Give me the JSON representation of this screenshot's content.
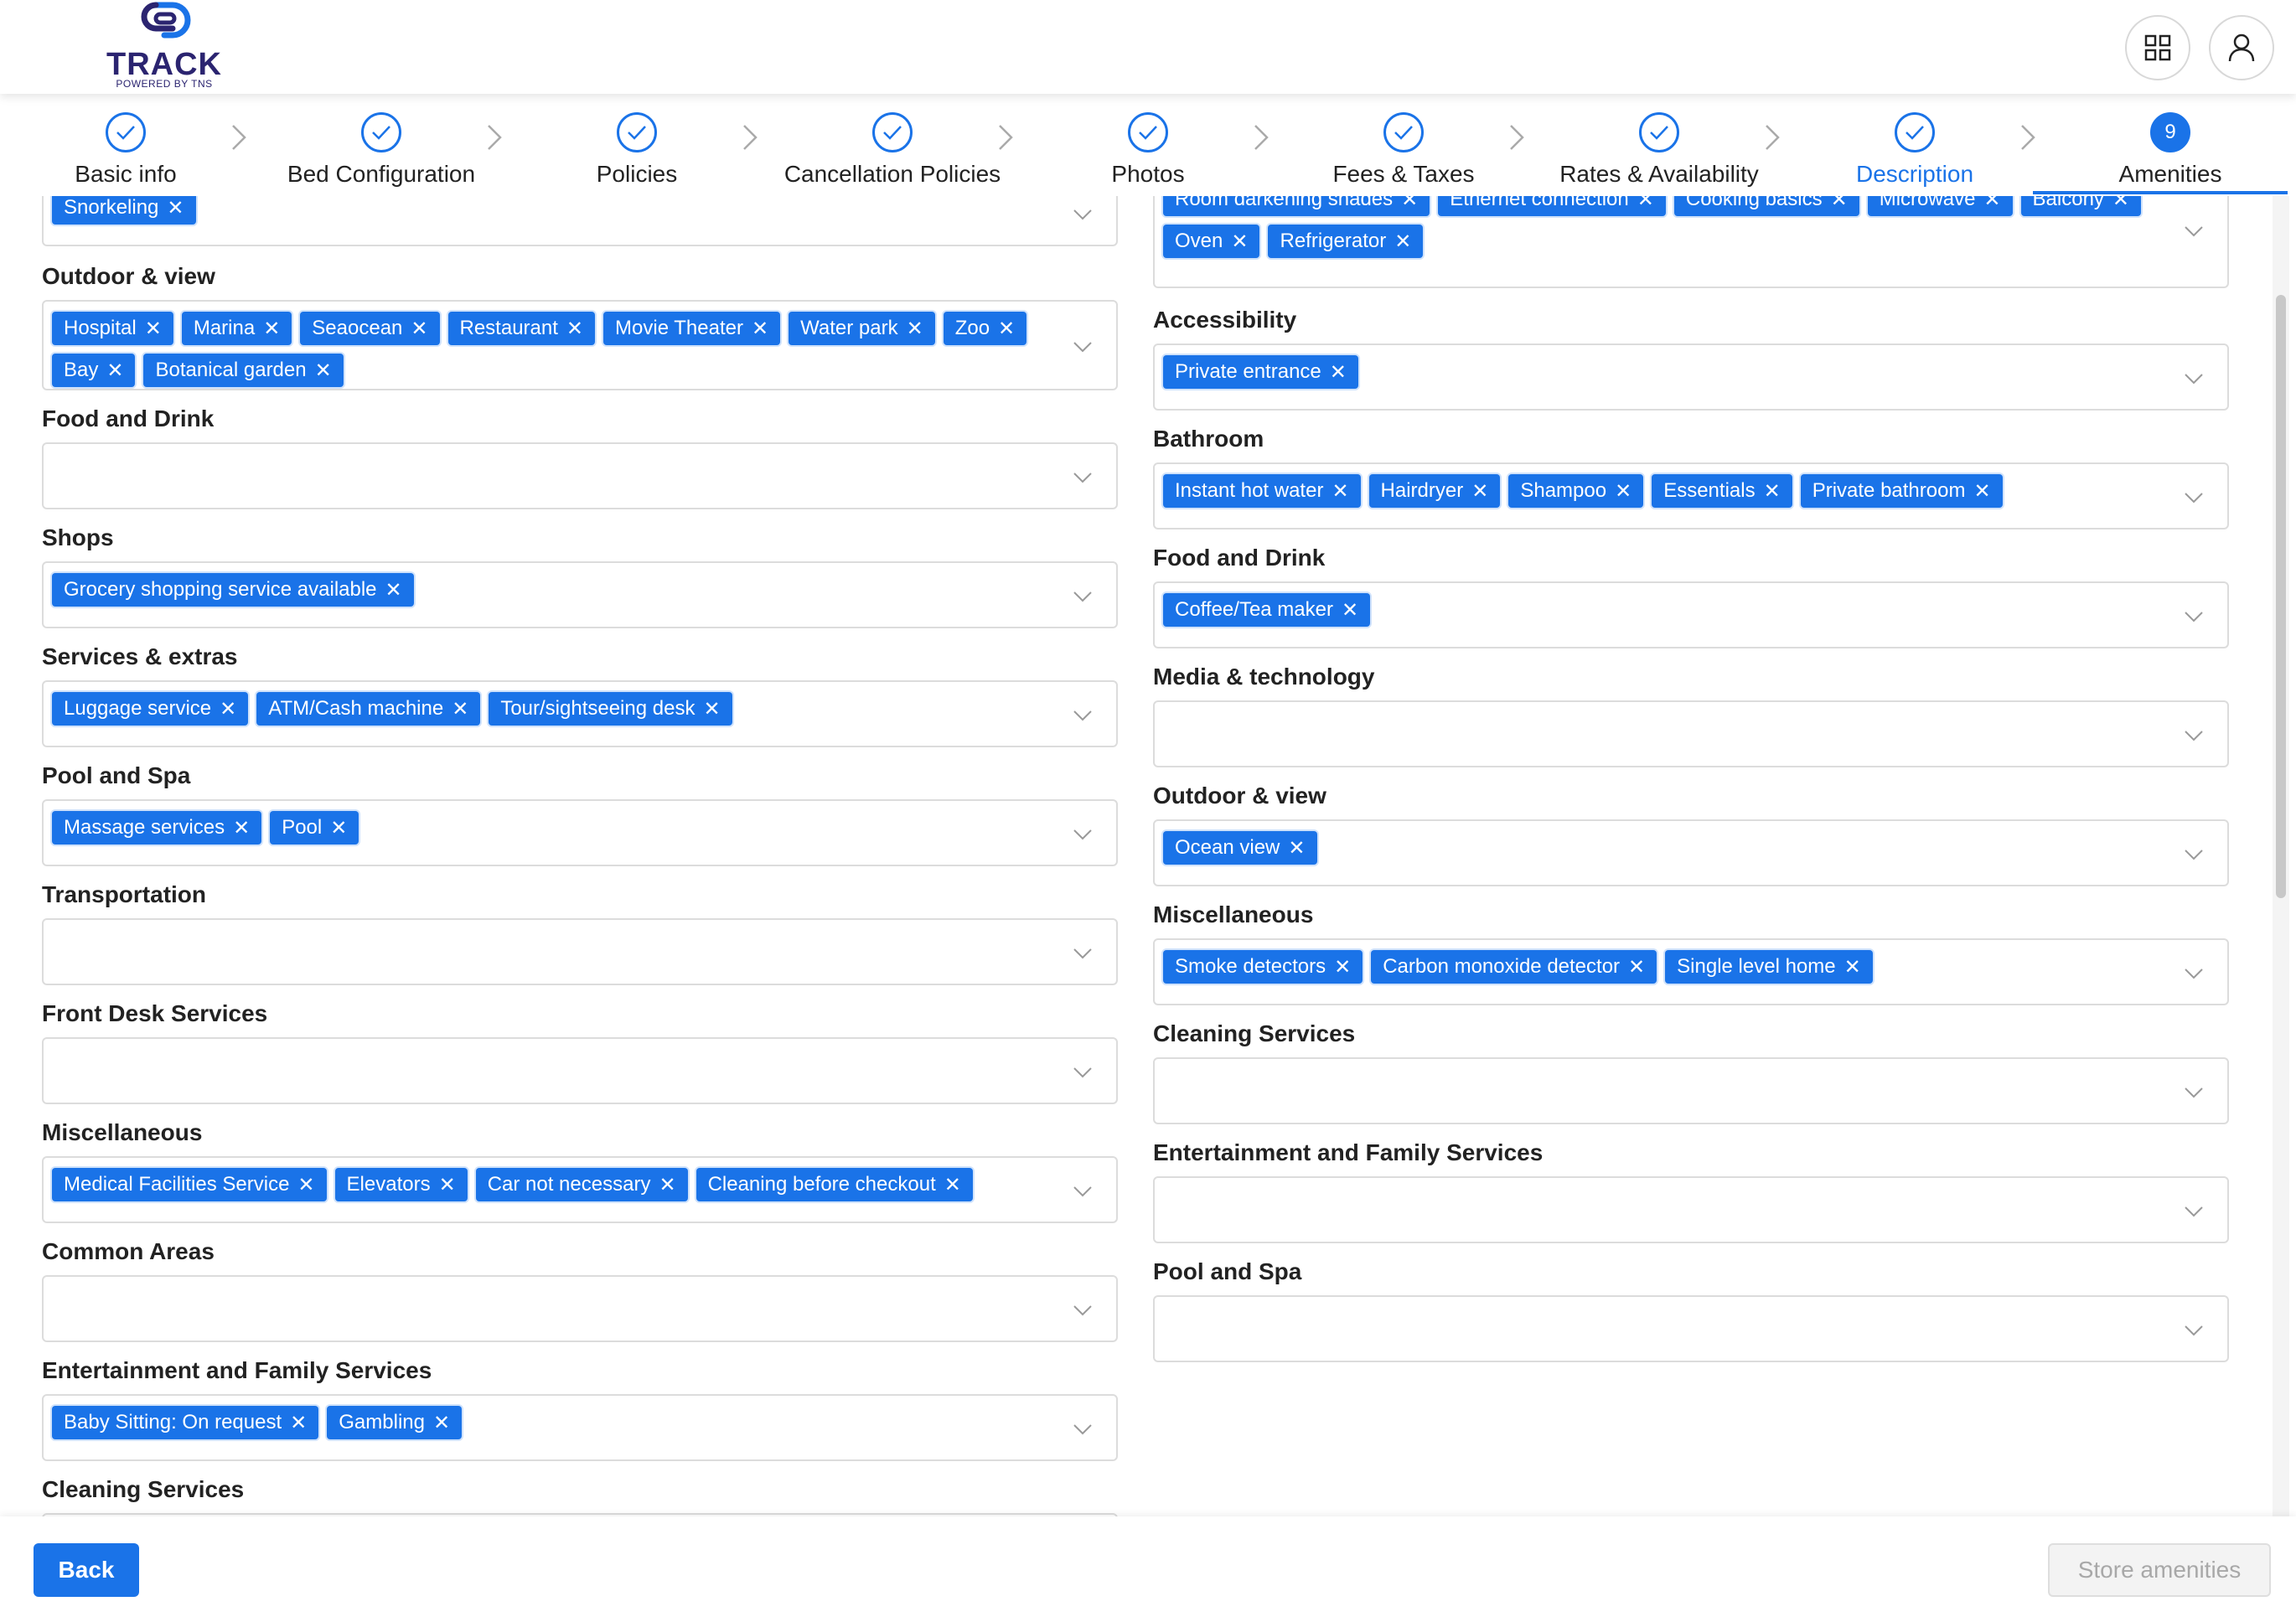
{
  "header": {
    "logo_text": "TRACK",
    "logo_subtext": "POWERED BY TNS",
    "apps_icon": "apps-grid-icon",
    "account_icon": "user-icon"
  },
  "steps": [
    {
      "label": "Basic info",
      "status": "done"
    },
    {
      "label": "Bed Configuration",
      "status": "done"
    },
    {
      "label": "Policies",
      "status": "done"
    },
    {
      "label": "Cancellation Policies",
      "status": "done"
    },
    {
      "label": "Photos",
      "status": "done"
    },
    {
      "label": "Fees & Taxes",
      "status": "done"
    },
    {
      "label": "Rates & Availability",
      "status": "done"
    },
    {
      "label": "Description",
      "status": "done"
    },
    {
      "label": "Amenities",
      "status": "active",
      "number": "9"
    }
  ],
  "left_sections": [
    {
      "title": "",
      "tags": [
        "Snorkeling"
      ]
    },
    {
      "title": "Outdoor & view",
      "tags": [
        "Hospital",
        "Marina",
        "Seaocean",
        "Restaurant",
        "Movie Theater",
        "Water park",
        "Zoo",
        "Bay",
        "Botanical garden"
      ]
    },
    {
      "title": "Food and Drink",
      "tags": []
    },
    {
      "title": "Shops",
      "tags": [
        "Grocery shopping service available"
      ]
    },
    {
      "title": "Services & extras",
      "tags": [
        "Luggage service",
        "ATM/Cash machine",
        "Tour/sightseeing desk"
      ]
    },
    {
      "title": "Pool and Spa",
      "tags": [
        "Massage services",
        "Pool"
      ]
    },
    {
      "title": "Transportation",
      "tags": []
    },
    {
      "title": "Front Desk Services",
      "tags": []
    },
    {
      "title": "Miscellaneous",
      "tags": [
        "Medical Facilities Service",
        "Elevators",
        "Car not necessary",
        "Cleaning before checkout"
      ]
    },
    {
      "title": "Common Areas",
      "tags": []
    },
    {
      "title": "Entertainment and Family Services",
      "tags": [
        "Baby Sitting: On request",
        "Gambling"
      ]
    },
    {
      "title": "Cleaning Services",
      "tags": []
    }
  ],
  "right_sections": [
    {
      "title": "",
      "tags": [
        "Room darkening shades",
        "Ethernet connection",
        "Cooking basics",
        "Microwave",
        "Balcony",
        "Oven",
        "Refrigerator"
      ]
    },
    {
      "title": "Accessibility",
      "tags": [
        "Private entrance"
      ]
    },
    {
      "title": "Bathroom",
      "tags": [
        "Instant hot water",
        "Hairdryer",
        "Shampoo",
        "Essentials",
        "Private bathroom"
      ]
    },
    {
      "title": "Food and Drink",
      "tags": [
        "Coffee/Tea maker"
      ]
    },
    {
      "title": "Media & technology",
      "tags": []
    },
    {
      "title": "Outdoor & view",
      "tags": [
        "Ocean view"
      ]
    },
    {
      "title": "Miscellaneous",
      "tags": [
        "Smoke detectors",
        "Carbon monoxide detector",
        "Single level home"
      ]
    },
    {
      "title": "Cleaning Services",
      "tags": []
    },
    {
      "title": "Entertainment and Family Services",
      "tags": []
    },
    {
      "title": "Pool and Spa",
      "tags": []
    }
  ],
  "footer": {
    "back_label": "Back",
    "store_label": "Store amenities"
  },
  "colors": {
    "primary": "#1a73e8",
    "logo": "#2b2470"
  }
}
